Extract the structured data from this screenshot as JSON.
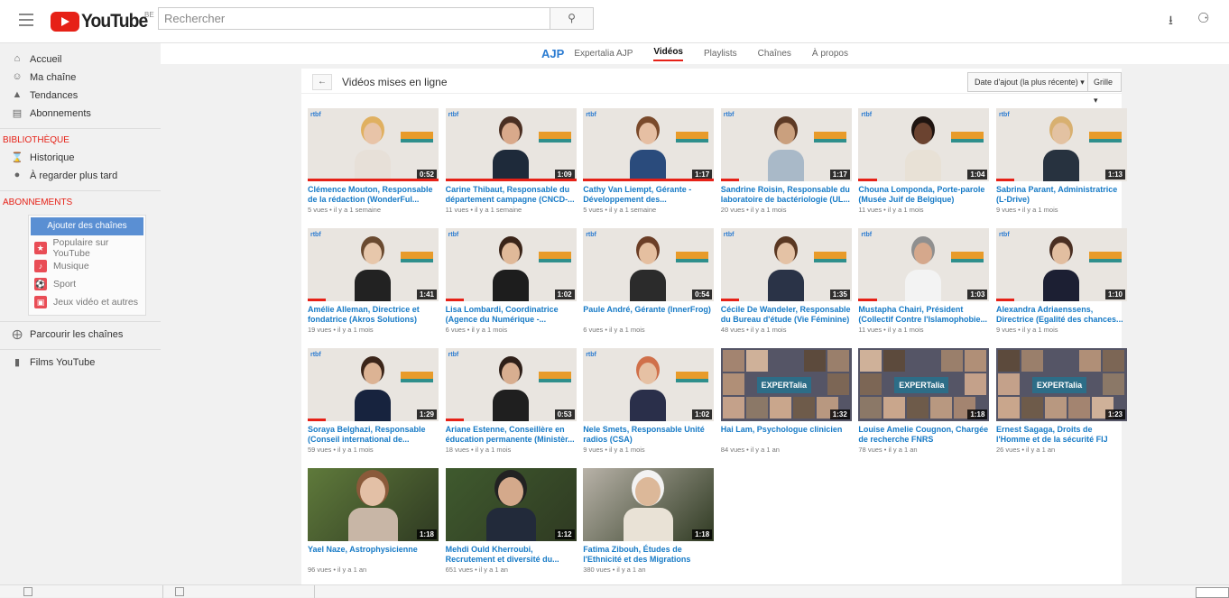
{
  "header": {
    "logo_text": "YouTube",
    "logo_country": "BE",
    "search_placeholder": "Rechercher"
  },
  "sidebar": {
    "nav": [
      {
        "label": "Accueil",
        "icon": "home-icon"
      },
      {
        "label": "Ma chaîne",
        "icon": "user-icon"
      },
      {
        "label": "Tendances",
        "icon": "flame-icon"
      },
      {
        "label": "Abonnements",
        "icon": "subscriptions-icon"
      }
    ],
    "library_title": "BIBLIOTHÈQUE",
    "library": [
      {
        "label": "Historique",
        "icon": "hourglass-icon"
      },
      {
        "label": "À regarder plus tard",
        "icon": "clock-icon"
      }
    ],
    "subs_title": "ABONNEMENTS",
    "add_channels": "Ajouter des chaînes",
    "subs": [
      {
        "label": "Populaire sur YouTube",
        "icon": "star-icon",
        "color": "#e94d56"
      },
      {
        "label": "Musique",
        "icon": "music-icon",
        "color": "#e94d56"
      },
      {
        "label": "Sport",
        "icon": "sport-icon",
        "color": "#e94d56"
      },
      {
        "label": "Jeux vidéo et autres",
        "icon": "gamepad-icon",
        "color": "#e94d56"
      }
    ],
    "browse": "Parcourir les chaînes",
    "films": "Films YouTube"
  },
  "channel": {
    "logo": "AJP",
    "tabs": [
      "Expertalia AJP",
      "Vidéos",
      "Playlists",
      "Chaînes",
      "À propos"
    ],
    "active_tab": "Vidéos"
  },
  "panel": {
    "title": "Vidéos mises en ligne",
    "sort": "Date d'ajout (la plus récente)",
    "view": "Grille"
  },
  "videos": [
    {
      "title": "Clémence Mouton, Responsable de la rédaction (WonderFul...",
      "meta": "5 vues • il y a 1 semaine",
      "duration": "0:52",
      "kind": "rtbf",
      "progress": 1
    },
    {
      "title": "Carine Thibaut, Responsable du département campagne (CNCD-...",
      "meta": "11 vues • il y a 1 semaine",
      "duration": "1:09",
      "kind": "rtbf",
      "progress": 1
    },
    {
      "title": "Cathy Van Liempt, Gérante - Développement des...",
      "meta": "5 vues • il y a 1 semaine",
      "duration": "1:17",
      "kind": "rtbf",
      "progress": 1
    },
    {
      "title": "Sandrine Roisin, Responsable du laboratoire de bactériologie (UL...",
      "meta": "20 vues • il y a 1 mois",
      "duration": "1:17",
      "kind": "rtbf",
      "progress": 0.14
    },
    {
      "title": "Chouna Lomponda, Porte-parole (Musée Juif de Belgique)",
      "meta": "11 vues • il y a 1 mois",
      "duration": "1:04",
      "kind": "rtbf",
      "progress": 0.14
    },
    {
      "title": "Sabrina Parant, Administratrice (L-Drive)",
      "meta": "9 vues • il y a 1 mois",
      "duration": "1:13",
      "kind": "rtbf",
      "progress": 0.14
    },
    {
      "title": "Amélie Alleman, Directrice et fondatrice (Akros Solutions)",
      "meta": "19 vues • il y a 1 mois",
      "duration": "1:41",
      "kind": "rtbf",
      "progress": 0.14
    },
    {
      "title": "Lisa Lombardi, Coordinatrice (Agence du Numérique -...",
      "meta": "6 vues • il y a 1 mois",
      "duration": "1:02",
      "kind": "rtbf",
      "progress": 0.14
    },
    {
      "title": "Paule André, Gérante (InnerFrog)",
      "meta": "6 vues • il y a 1 mois",
      "duration": "0:54",
      "kind": "rtbf",
      "progress": 0
    },
    {
      "title": "Cécile De Wandeler, Responsable du Bureau d'étude (Vie Féminine)",
      "meta": "48 vues • il y a 1 mois",
      "duration": "1:35",
      "kind": "rtbf",
      "progress": 0.14
    },
    {
      "title": "Mustapha Chairi, Président (Collectif Contre l'Islamophobie...",
      "meta": "11 vues • il y a 1 mois",
      "duration": "1:03",
      "kind": "rtbf",
      "progress": 0.14
    },
    {
      "title": "Alexandra Adriaenssens, Directrice (Egalité des chances...",
      "meta": "9 vues • il y a 1 mois",
      "duration": "1:10",
      "kind": "rtbf",
      "progress": 0.14
    },
    {
      "title": "Soraya Belghazi, Responsable (Conseil international de...",
      "meta": "59 vues • il y a 1 mois",
      "duration": "1:29",
      "kind": "rtbf",
      "progress": 0.14
    },
    {
      "title": "Ariane Estenne, Conseillère en éducation permanente (Ministèr...",
      "meta": "18 vues • il y a 1 mois",
      "duration": "0:53",
      "kind": "rtbf",
      "progress": 0.14
    },
    {
      "title": "Nele Smets, Responsable Unité radios (CSA)",
      "meta": "9 vues • il y a 1 mois",
      "duration": "1:02",
      "kind": "rtbf",
      "progress": 0
    },
    {
      "title": "Hai Lam, Psychologue clinicien",
      "meta": "84 vues • il y a 1 an",
      "duration": "1:32",
      "kind": "expertalia",
      "progress": 0
    },
    {
      "title": "Louise Amelie Cougnon, Chargée de recherche FNRS",
      "meta": "78 vues • il y a 1 an",
      "duration": "1:18",
      "kind": "expertalia",
      "progress": 0
    },
    {
      "title": "Ernest Sagaga, Droits de l'Homme et de la sécurité FIJ",
      "meta": "26 vues • il y a 1 an",
      "duration": "1:23",
      "kind": "expertalia",
      "progress": 0
    },
    {
      "title": "Yael Naze, Astrophysicienne",
      "meta": "96 vues • il y a 1 an",
      "duration": "1:18",
      "kind": "photo",
      "progress": 0
    },
    {
      "title": "Mehdi Ould Kherroubi, Recrutement et diversité du...",
      "meta": "651 vues • il y a 1 an",
      "duration": "1:12",
      "kind": "photo",
      "progress": 0
    },
    {
      "title": "Fatima Zibouh, Études de l'Ethnicité et des Migrations",
      "meta": "380 vues • il y a 1 an",
      "duration": "1:18",
      "kind": "photo",
      "progress": 0
    }
  ],
  "expert_label": "EXPERTalia",
  "brand_label": "rtbf"
}
